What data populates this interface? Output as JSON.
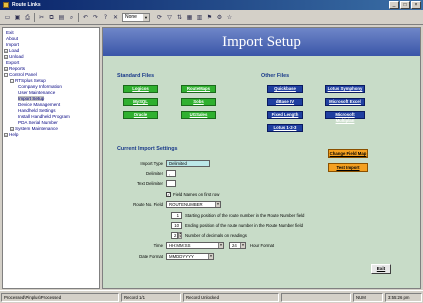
{
  "window": {
    "title": "Route Links"
  },
  "toolbar": {
    "combo_value": "None"
  },
  "sidebar": {
    "items": [
      {
        "label": "Exit",
        "toggle": ""
      },
      {
        "label": "About",
        "toggle": ""
      },
      {
        "label": "Import",
        "toggle": ""
      },
      {
        "label": "Load",
        "toggle": "+"
      },
      {
        "label": "Unload",
        "toggle": "+"
      },
      {
        "label": "Export",
        "toggle": ""
      },
      {
        "label": "Reports",
        "toggle": "+"
      },
      {
        "label": "Control Panel",
        "toggle": "-"
      },
      {
        "label": "RTSplus Setup",
        "toggle": "-"
      },
      {
        "label": "Company Information",
        "toggle": ""
      },
      {
        "label": "User Maintenance",
        "toggle": ""
      },
      {
        "label": "Import Setup",
        "toggle": ""
      },
      {
        "label": "Device Management",
        "toggle": ""
      },
      {
        "label": "Handheld Settings",
        "toggle": ""
      },
      {
        "label": "Install Handheld Program",
        "toggle": ""
      },
      {
        "label": "PDA Serial Number",
        "toggle": ""
      },
      {
        "label": "System Maintenance",
        "toggle": "+"
      },
      {
        "label": "Help",
        "toggle": "+"
      }
    ]
  },
  "header": {
    "title": "Import Setup"
  },
  "standard_files": {
    "heading": "Standard Files",
    "buttons": [
      "Logicos",
      "RouteMaps",
      "MySQL",
      "Sobs",
      "Oracle",
      "UGSales"
    ]
  },
  "other_files": {
    "heading": "Other Files",
    "buttons": [
      "Quickbase",
      "Lotus Symphony",
      "dBase IV",
      "Microsoft Excel",
      "Fixed Length",
      "Microsoft Multiplan",
      "Lotus 1-2-3"
    ]
  },
  "current_settings": {
    "heading": "Current Import Settings",
    "import_type_label": "Import Type",
    "import_type_value": "Delimited",
    "delimiter_label": "Delimiter",
    "delimiter_value": ",",
    "text_delimiter_label": "Text Delimiter",
    "text_delimiter_value": "",
    "field_names_label": "Field Names on first row",
    "field_names_checked": true,
    "route_no_label": "Route No. Field",
    "route_no_value": "ROUTENUMBER",
    "start_pos_value": "1",
    "start_pos_label": "Starting position of the route number in the Route Number field",
    "end_pos_value": "10",
    "end_pos_label": "Ending position of the route number in the Route Number field",
    "decimals_value": "2",
    "decimals_label": "Number of decimals on readings",
    "time_label": "Time",
    "time_value": "HH:MM:SS",
    "hour_value": "24",
    "hour_label": "Hour Format",
    "date_format_label": "Date Format",
    "date_format_value": "MMDDYYYY"
  },
  "actions": {
    "change_field_map": "Change Field Map",
    "test_import": "Test Import",
    "exit": "Exit"
  },
  "status": {
    "path": "Processed\\Pinplus\\Processed",
    "record": "Record 1/1",
    "state": "Record Unlocked",
    "mode": "NUM",
    "time": "3:55:26 pm"
  },
  "colors": {
    "green_button": "#2fb02f",
    "blue_button": "#1f3fa0",
    "orange_button": "#f4a020",
    "banner": "#3a56a8",
    "panel": "#c8dcc8"
  }
}
